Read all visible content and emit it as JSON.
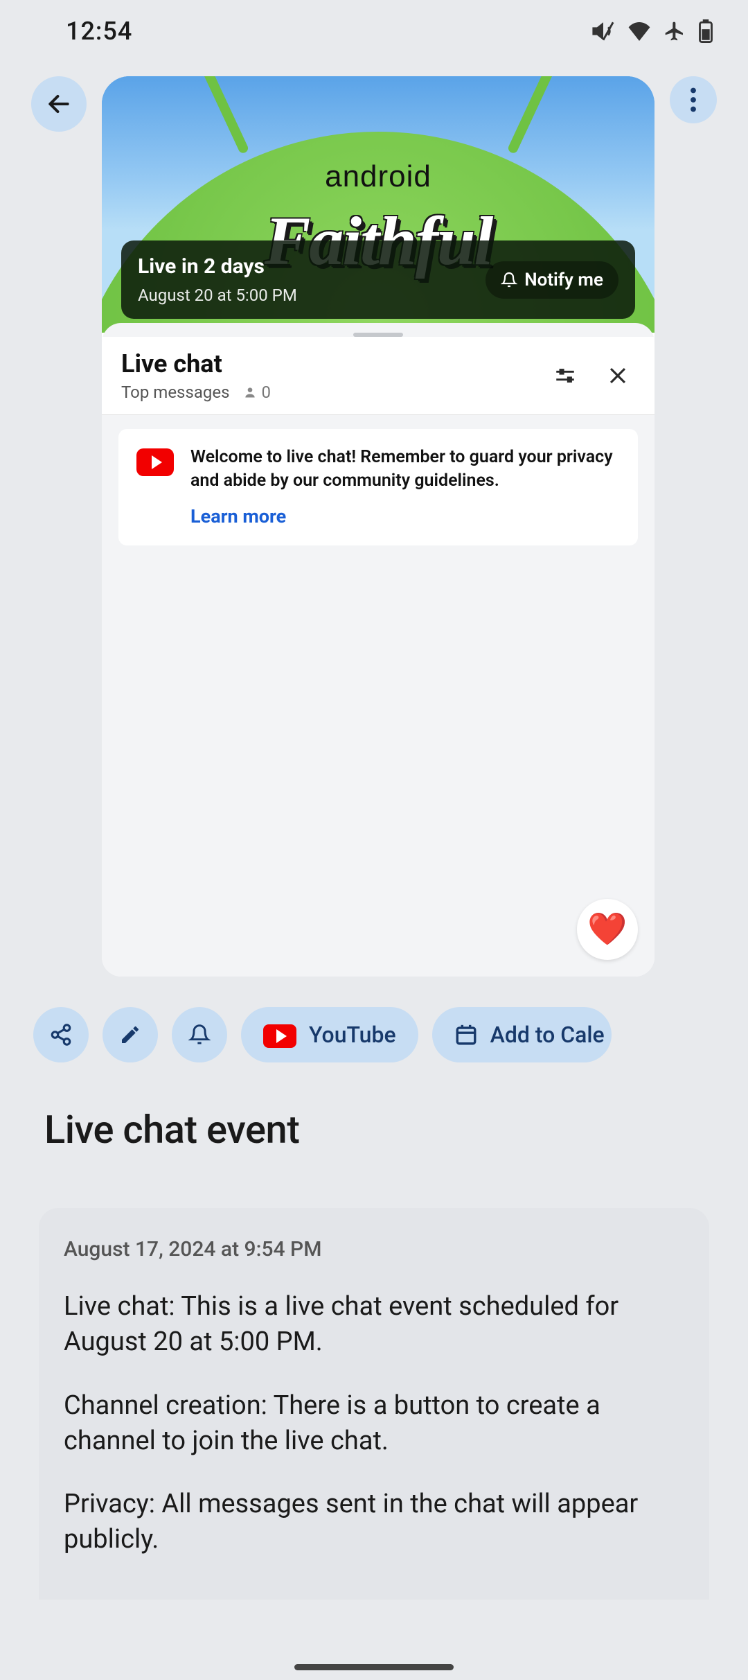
{
  "status_bar": {
    "time": "12:54",
    "icons": [
      "volume-muted",
      "wifi",
      "airplane",
      "battery"
    ]
  },
  "video": {
    "brand_top": "android",
    "brand_script": "Faithful",
    "live_title": "Live in 2 days",
    "live_subtitle": "August 20 at 5:00 PM",
    "notify_label": "Notify me"
  },
  "chat": {
    "title": "Live chat",
    "filter_label": "Top messages",
    "viewer_count": "0",
    "welcome_text": "Welcome to live chat! Remember to guard your privacy and abide by our community guidelines.",
    "learn_more": "Learn more",
    "heart_emoji": "❤️"
  },
  "actions": {
    "share": "share",
    "edit": "edit",
    "notify": "notify",
    "youtube_label": "YouTube",
    "calendar_label": "Add to Cale"
  },
  "page": {
    "title": "Live chat event"
  },
  "note": {
    "date": "August 17, 2024 at 9:54 PM",
    "p1": "Live chat: This is a live chat event scheduled for August 20 at 5:00 PM.",
    "p2": "Channel creation: There is a button to create a channel to join the live chat.",
    "p3": "Privacy: All messages sent in the chat will appear publicly."
  }
}
